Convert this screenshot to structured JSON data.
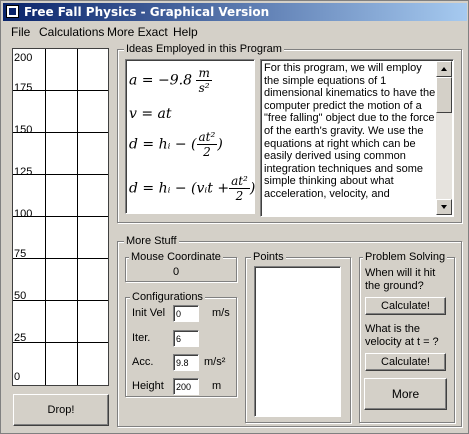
{
  "window": {
    "title": "Free Fall Physics - Graphical Version"
  },
  "menu": {
    "items": [
      "File",
      "Calculations",
      "More Exact",
      "Help"
    ]
  },
  "graph": {
    "y_labels": [
      "200",
      "175",
      "150",
      "125",
      "100",
      "75",
      "50",
      "25",
      "0"
    ]
  },
  "drop_button": "Drop!",
  "ideas": {
    "legend": "Ideas Employed in this Program",
    "description": "For this program, we will employ the simple equations of 1 dimensional kinematics to have the computer predict the motion of a \"free falling\" object due to the force of the earth's gravity. We use the equations at right which can be easily derived using common integration techniques and some simple thinking about what acceleration, velocity, and"
  },
  "equations": {
    "a_lhs": "a = −9.8",
    "a_num": "m",
    "a_den": "s²",
    "v": "v = at",
    "d1_lhs": "d = hᵢ − (",
    "d1_num": "at²",
    "d1_den": "2",
    "d1_rhs": ")",
    "d2_lhs": "d = hᵢ − (vᵢt +",
    "d2_num": "at²",
    "d2_den": "2",
    "d2_rhs": ")"
  },
  "more_stuff": {
    "legend": "More Stuff",
    "mouse": {
      "legend": "Mouse Coordinate",
      "value": "0"
    },
    "config": {
      "legend": "Configurations",
      "init_vel": {
        "label": "Init Vel",
        "value": "0",
        "unit": "m/s"
      },
      "iter": {
        "label": "Iter.",
        "value": "6"
      },
      "acc": {
        "label": "Acc.",
        "value": "9.8",
        "unit": "m/s²"
      },
      "height": {
        "label": "Height",
        "value": "200",
        "unit": "m"
      }
    },
    "points": {
      "legend": "Points"
    },
    "problem": {
      "legend": "Problem Solving",
      "q1": "When will it hit the ground?",
      "calc1": "Calculate!",
      "q2": "What is the velocity at t = ?",
      "calc2": "Calculate!",
      "more": "More"
    }
  }
}
